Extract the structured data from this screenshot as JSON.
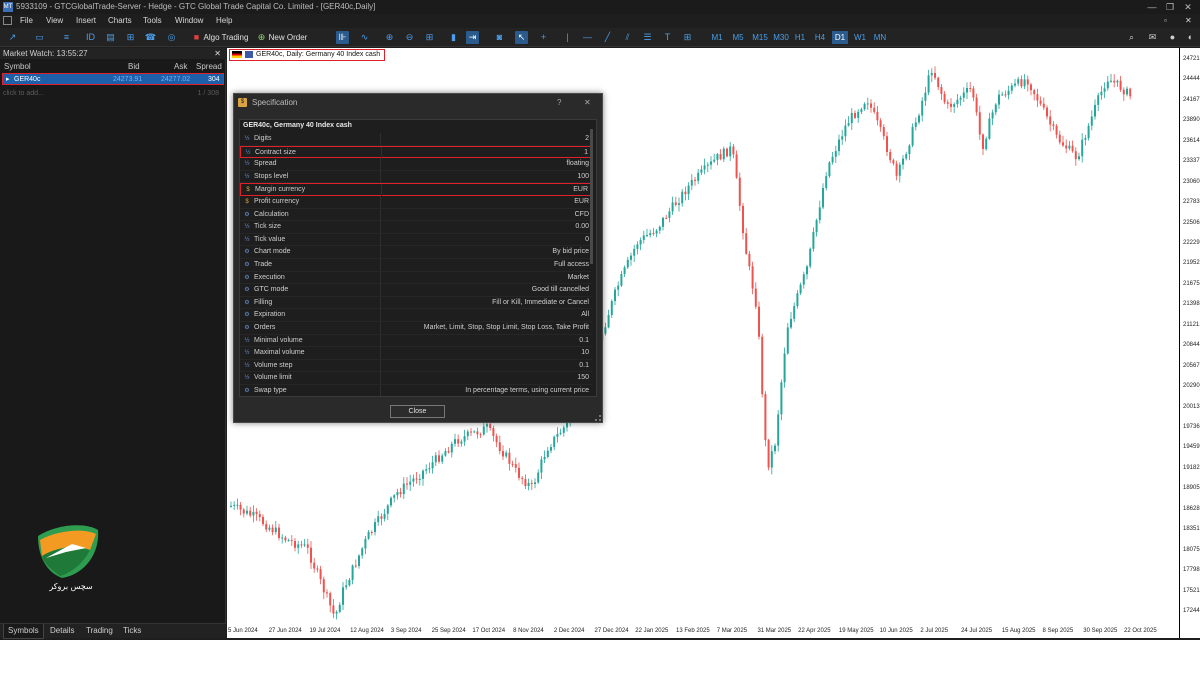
{
  "window": {
    "title": "5933109 - GTCGlobalTrade-Server - Hedge - GTC Global Trade Capital Co. Limited - [GER40c,Daily]"
  },
  "menu": [
    "File",
    "View",
    "Insert",
    "Charts",
    "Tools",
    "Window",
    "Help"
  ],
  "toolbar": {
    "algo_trading": "Algo Trading",
    "new_order": "New Order",
    "timeframes": [
      "M1",
      "M5",
      "M15",
      "M30",
      "H1",
      "H4",
      "D1",
      "W1",
      "MN"
    ],
    "active_timeframe": "D1"
  },
  "market_watch": {
    "title": "Market Watch: 13:55:27",
    "columns": {
      "symbol": "Symbol",
      "bid": "Bid",
      "ask": "Ask",
      "spread": "Spread"
    },
    "rows": [
      {
        "symbol": "GER40c",
        "bid": "24273.91",
        "ask": "24277.02",
        "spread": "304"
      }
    ],
    "add_placeholder": "click to add...",
    "count": "1 / 308",
    "tabs": [
      "Symbols",
      "Details",
      "Trading",
      "Ticks"
    ],
    "active_tab": "Symbols"
  },
  "logo": {
    "text": "سچس بروکر"
  },
  "chart": {
    "symbol_label": "GER40c, Daily:  Germany 40 Index cash",
    "colors": {
      "up": "#26a69a",
      "down": "#ef5350"
    },
    "price_ticks": [
      "24721.5",
      "24444.",
      "24167.",
      "23890.",
      "23614.",
      "23337.",
      "23060.",
      "22783.",
      "22506.",
      "22229.",
      "21952.",
      "21675.",
      "21398.",
      "21121.",
      "20844.",
      "20567.",
      "20290.",
      "20013.",
      "19736.",
      "19459.",
      "19182.",
      "18905.",
      "18628.",
      "18351.",
      "18075.",
      "17798.",
      "17521.",
      "17244."
    ],
    "date_ticks": [
      "5 Jun 2024",
      "27 Jun 2024",
      "19 Jul 2024",
      "12 Aug 2024",
      "3 Sep 2024",
      "25 Sep 2024",
      "17 Oct 2024",
      "8 Nov 2024",
      "2 Dec 2024",
      "27 Dec 2024",
      "22 Jan 2025",
      "13 Feb 2025",
      "7 Mar 2025",
      "31 Mar 2025",
      "22 Apr 2025",
      "19 May 2025",
      "10 Jun 2025",
      "2 Jul 2025",
      "24 Jul 2025",
      "15 Aug 2025",
      "8 Sep 2025",
      "30 Sep 2025",
      "22 Oct 2025"
    ]
  },
  "dialog": {
    "title": "Specification",
    "help": "?",
    "close_x": "✕",
    "header": "GER40c, Germany 40 Index cash",
    "rows": [
      {
        "name": "Digits",
        "value": "2",
        "icon": "½"
      },
      {
        "name": "Contract size",
        "value": "1",
        "icon": "½",
        "highlight": true
      },
      {
        "name": "Spread",
        "value": "floating",
        "icon": "½"
      },
      {
        "name": "Stops level",
        "value": "100",
        "icon": "½"
      },
      {
        "name": "Margin currency",
        "value": "EUR",
        "icon": "$",
        "highlight": true
      },
      {
        "name": "Profit currency",
        "value": "EUR",
        "icon": "$"
      },
      {
        "name": "Calculation",
        "value": "CFD",
        "icon": "⚙"
      },
      {
        "name": "Tick size",
        "value": "0.00",
        "icon": "½"
      },
      {
        "name": "Tick value",
        "value": "0",
        "icon": "½"
      },
      {
        "name": "Chart mode",
        "value": "By bid price",
        "icon": "⚙"
      },
      {
        "name": "Trade",
        "value": "Full access",
        "icon": "⚙"
      },
      {
        "name": "Execution",
        "value": "Market",
        "icon": "⚙"
      },
      {
        "name": "GTC mode",
        "value": "Good till cancelled",
        "icon": "⚙"
      },
      {
        "name": "Filling",
        "value": "Fill or Kill, Immediate or Cancel",
        "icon": "⚙"
      },
      {
        "name": "Expiration",
        "value": "All",
        "icon": "⚙"
      },
      {
        "name": "Orders",
        "value": "Market, Limit, Stop, Stop Limit, Stop Loss, Take Profit",
        "icon": "⚙"
      },
      {
        "name": "Minimal volume",
        "value": "0.1",
        "icon": "½"
      },
      {
        "name": "Maximal volume",
        "value": "10",
        "icon": "½"
      },
      {
        "name": "Volume step",
        "value": "0.1",
        "icon": "½"
      },
      {
        "name": "Volume limit",
        "value": "150",
        "icon": "½"
      },
      {
        "name": "Swap type",
        "value": "In percentage terms, using current price",
        "icon": "⚙"
      }
    ],
    "close_label": "Close"
  }
}
